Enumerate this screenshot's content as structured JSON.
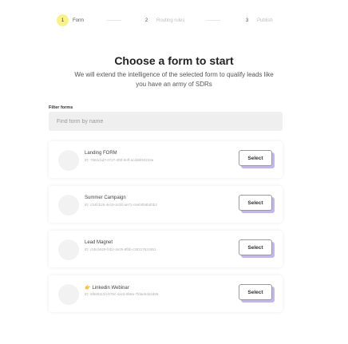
{
  "stepper": {
    "steps": [
      {
        "number": "1",
        "label": "Form"
      },
      {
        "number": "2",
        "label": "Routing rules"
      },
      {
        "number": "3",
        "label": "Publish"
      }
    ]
  },
  "header": {
    "title": "Choose a form to start",
    "subtitle": "We will extend the intelligence of the selected form to qualify leads like you have an army of SDRs"
  },
  "filter": {
    "label": "Filter forms",
    "placeholder": "Find form by name"
  },
  "forms": [
    {
      "name": "Landing FORM",
      "id": "ID: 7582cbd7-0727-4f8f-9eff-acdd6f40233a",
      "select_label": "Select"
    },
    {
      "name": "Summer Campaign",
      "id": "ID: c34fcb26-4e19-4c2b-ae71-c6eb0b6bd0b2",
      "select_label": "Select"
    },
    {
      "name": "Lead Magnet",
      "id": "ID: c55cb929-f4b2-4e29-8fbb-c2831762c861",
      "select_label": "Select"
    },
    {
      "name": "Linkedin Webinar",
      "emoji": "👉",
      "id": "ID: 6f6801134-b75c-4ac6-9b8a-7fdae54b2d65",
      "select_label": "Select"
    }
  ]
}
